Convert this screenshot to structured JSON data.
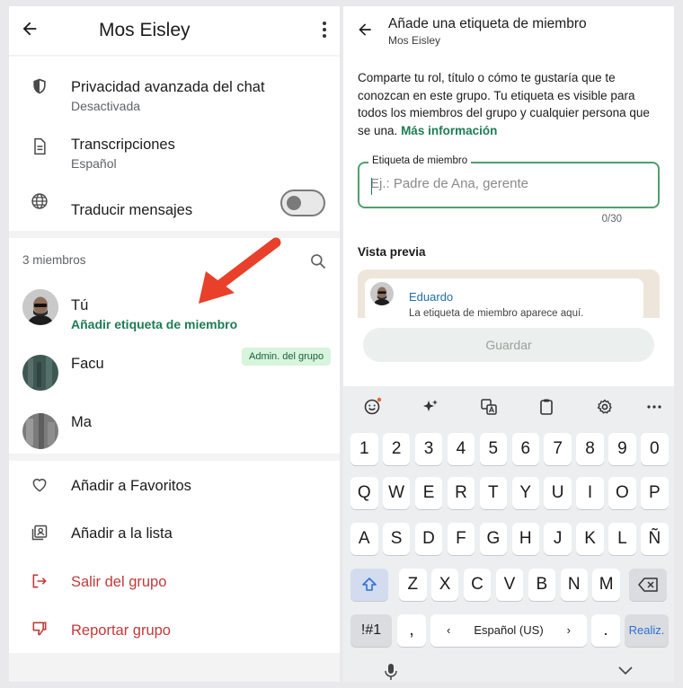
{
  "left": {
    "header": {
      "title": "Mos Eisley"
    },
    "settings": [
      {
        "title": "Privacidad avanzada del chat",
        "subtitle": "Desactivada",
        "icon": "shield-icon"
      },
      {
        "title": "Transcripciones",
        "subtitle": "Español",
        "icon": "document-icon"
      },
      {
        "title": "Traducir mensajes",
        "icon": "globe-icon",
        "toggle_on": false
      }
    ],
    "members": {
      "heading": "3 miembros",
      "items": [
        {
          "name": "Tú",
          "action": "Añadir etiqueta de miembro"
        },
        {
          "name": "Facu",
          "badge": "Admin. del grupo"
        },
        {
          "name": "Ma"
        }
      ]
    },
    "actions": [
      {
        "label": "Añadir a Favoritos",
        "icon": "heart-icon"
      },
      {
        "label": "Añadir a la lista",
        "icon": "contact-list-icon"
      },
      {
        "label": "Salir del grupo",
        "icon": "exit-icon"
      },
      {
        "label": "Reportar grupo",
        "icon": "thumbs-down-icon"
      }
    ],
    "annotation_color": "#e8402b"
  },
  "right": {
    "header": {
      "title": "Añade una etiqueta de miembro",
      "subtitle": "Mos Eisley"
    },
    "description": "Comparte tu rol, título o cómo te gustaría que te conozcan en este grupo. Tu etiqueta es visible para todos los miembros del grupo y cualquier persona que se una.",
    "more_info": "Más información",
    "field": {
      "label": "Etiqueta de miembro",
      "placeholder": "Ej.: Padre de Ana, gerente",
      "value": "",
      "counter": "0/30"
    },
    "preview": {
      "heading": "Vista previa",
      "name": "Eduardo",
      "text": "La etiqueta de miembro aparece aquí."
    },
    "save": "Guardar",
    "keyboard": {
      "row_numbers": [
        "1",
        "2",
        "3",
        "4",
        "5",
        "6",
        "7",
        "8",
        "9",
        "0"
      ],
      "row1": [
        "Q",
        "W",
        "E",
        "R",
        "T",
        "Y",
        "U",
        "I",
        "O",
        "P"
      ],
      "row2": [
        "A",
        "S",
        "D",
        "F",
        "G",
        "H",
        "J",
        "K",
        "L",
        "Ñ"
      ],
      "row3": [
        "Z",
        "X",
        "C",
        "V",
        "B",
        "N",
        "M"
      ],
      "symbols": "!#1",
      "comma": ",",
      "space": "Español (US)",
      "period": ".",
      "action": "Realiz."
    }
  },
  "colors": {
    "accent_green": "#1c7d52",
    "danger_red": "#c23a3a"
  }
}
